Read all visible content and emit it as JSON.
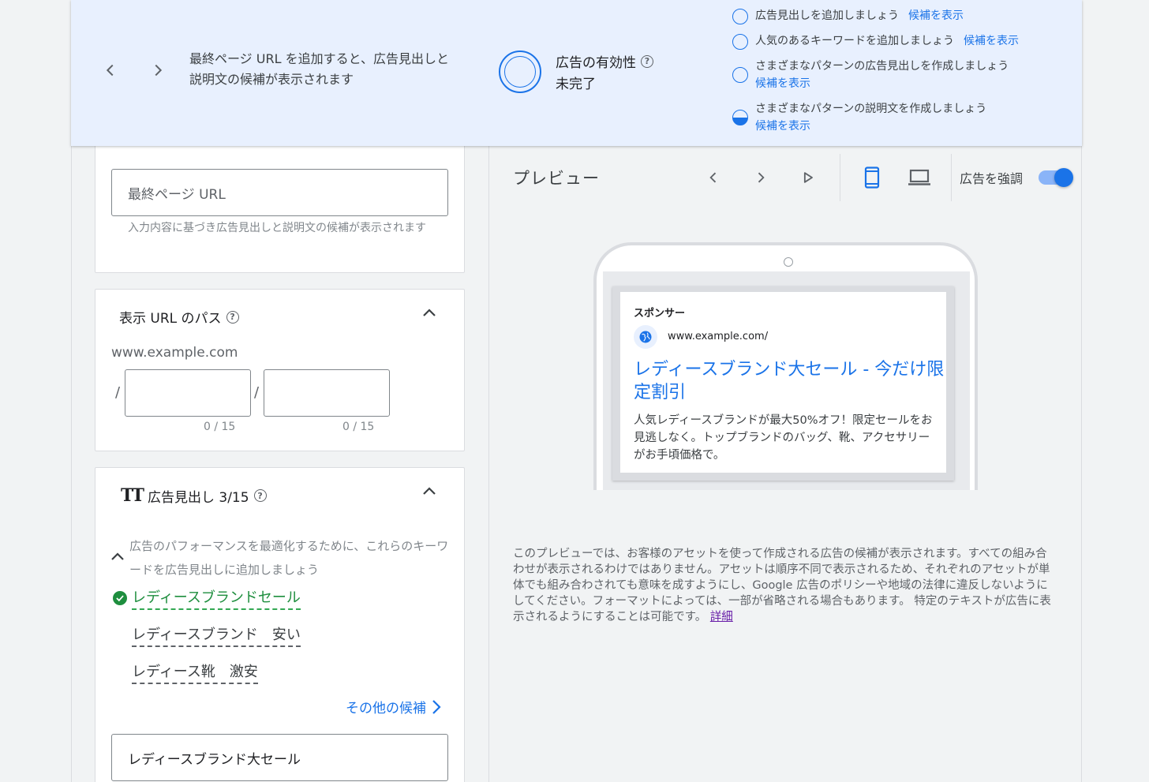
{
  "banner": {
    "message": "最終ページ URL を追加すると、広告見出しと説明文の候補が表示されます",
    "strength_title": "広告の有効性",
    "strength_status": "未完了",
    "tips": [
      {
        "text": "広告見出しを追加しましょう",
        "link": "候補を表示",
        "state": "empty"
      },
      {
        "text": "人気のあるキーワードを追加しましょう",
        "link": "候補を表示",
        "state": "empty"
      },
      {
        "text": "さまざまなパターンの広告見出しを作成しましょう",
        "link": "候補を表示",
        "state": "empty"
      },
      {
        "text": "さまざまなパターンの説明文を作成しましょう",
        "link": "候補を表示",
        "state": "half"
      }
    ]
  },
  "final_url": {
    "placeholder": "最終ページ URL",
    "hint": "入力内容に基づき広告見出しと説明文の候補が表示されます"
  },
  "display_path": {
    "title": "表示 URL のパス",
    "base_url": "www.example.com",
    "separator": "/",
    "path1_counter": "0 / 15",
    "path2_counter": "0 / 15"
  },
  "headlines": {
    "title": "広告見出し 3/15",
    "suggestion_hint": "広告のパフォーマンスを最適化するために、これらのキーワードを広告見出しに追加しましょう",
    "keywords": [
      {
        "text": "レディースブランドセール",
        "added": true
      },
      {
        "text": "レディースブランド　安い",
        "added": false
      },
      {
        "text": "レディース靴　激安",
        "added": false
      }
    ],
    "more_link": "その他の候補",
    "headline1_value": "レディースブランド大セール"
  },
  "preview": {
    "title": "プレビュー",
    "toggle_label": "広告を強調",
    "toggle_on": true,
    "ad": {
      "sponsor": "スポンサー",
      "url": "www.example.com/",
      "headline": "レディースブランド大セール - 今だけ限定割引",
      "description": "人気レディースブランドが最大50%オフ！限定セールをお見逃しなく。トップブランドのバッグ、靴、アクセサリーがお手頃価格で。"
    },
    "note": "このプレビューでは、お客様のアセットを使って作成される広告の候補が表示されます。すべての組み合わせが表示されるわけではありません。アセットは順序不同で表示されるため、それぞれのアセットが単体でも組み合わされても意味を成すようにし、Google 広告のポリシーや地域の法律に違反しないようにしてください。フォーマットによっては、一部が省略される場合もあります。 特定のテキストが広告に表示されるようにすることは可能です。",
    "note_link": "詳細"
  },
  "colors": {
    "accent": "#1a73e8",
    "banner_bg": "#e8f0fe",
    "success": "#1e8e3e"
  }
}
